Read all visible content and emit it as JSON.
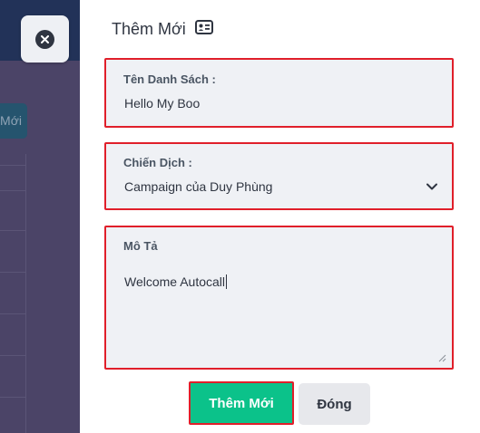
{
  "background": {
    "button_label": "Mới"
  },
  "panel": {
    "title": "Thêm Mới",
    "title_icon": "contact-card-icon"
  },
  "form": {
    "name": {
      "label": "Tên Danh Sách :",
      "value": "Hello My Boo"
    },
    "campaign": {
      "label": "Chiến Dịch :",
      "selected": "Campaign của Duy Phùng",
      "icon": "chevron-down-icon"
    },
    "description": {
      "label": "Mô Tả",
      "value": "Welcome Autocall"
    }
  },
  "actions": {
    "submit_label": "Thêm Mới",
    "close_label": "Đóng"
  },
  "colors": {
    "highlight": "#e01f2a",
    "primary": "#0bc28a",
    "overlay": "#4b4467",
    "field_bg": "#eff1f5"
  }
}
